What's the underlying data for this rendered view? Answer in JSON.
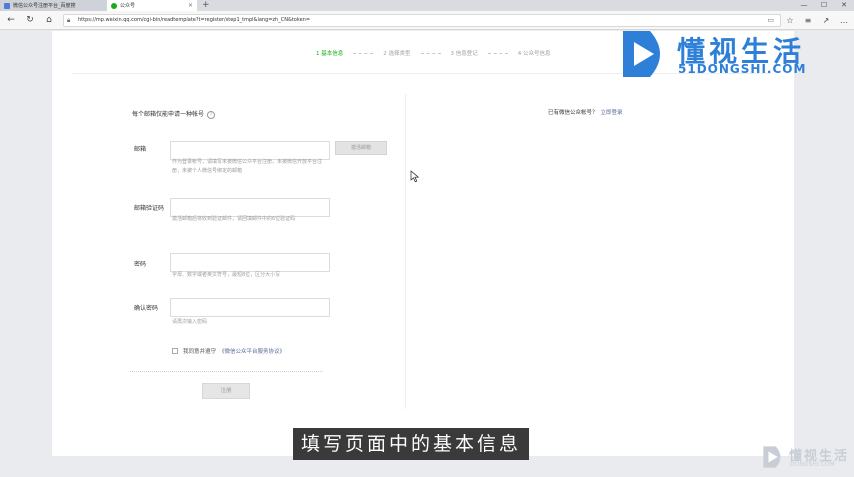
{
  "browser": {
    "tabs": [
      {
        "label": "微信公众号注册平台_百度搜",
        "active": false,
        "favicon_color": "#4f7bd9"
      },
      {
        "label": "公众号",
        "active": true,
        "favicon_color": "#1aad19"
      }
    ],
    "new_tab_symbol": "+",
    "window_controls": [
      "—",
      "☐",
      "✕"
    ],
    "url": "https://mp.weixin.qq.com/cgi-bin/readtemplate?t=register/step1_tmpl&lang=zh_CN&token="
  },
  "steps": [
    {
      "label": "1 基本信息",
      "active": true
    },
    {
      "label": "2 选择类型",
      "active": false
    },
    {
      "label": "3 信息登记",
      "active": false
    },
    {
      "label": "4 公众号信息",
      "active": false
    }
  ],
  "form": {
    "title": "每个邮箱仅能申请一种帐号",
    "help_symbol": "?",
    "email_label": "邮箱",
    "email_value": "",
    "email_tip": "作为登录帐号，请填写未被微信公众平台注册，未被微信开放平台注册，未被个人微信号绑定的邮箱",
    "activate_label": "激活邮箱",
    "code_label": "邮箱验证码",
    "code_value": "",
    "code_tip": "激活邮箱后将收到验证邮件，请回填邮件中的6位验证码",
    "password_label": "密码",
    "password_value": "",
    "password_tip": "字母、数字或者英文符号，最短8位，区分大小写",
    "confirm_label": "确认密码",
    "confirm_value": "",
    "confirm_tip": "请再次输入密码",
    "agree_text": "我同意并遵守",
    "agree_link": "《微信公众平台服务协议》",
    "agree_checked": false,
    "register_label": "注册"
  },
  "login_hint": {
    "text": "已有微信公众帐号？",
    "link": "立即登录"
  },
  "watermark": {
    "brand_cn": "懂视生活",
    "brand_en": "51DONGSHI.COM",
    "small_en": "DONGSHI.COM",
    "brand_color": "#2e7fd8"
  },
  "subtitle": "填写页面中的基本信息"
}
